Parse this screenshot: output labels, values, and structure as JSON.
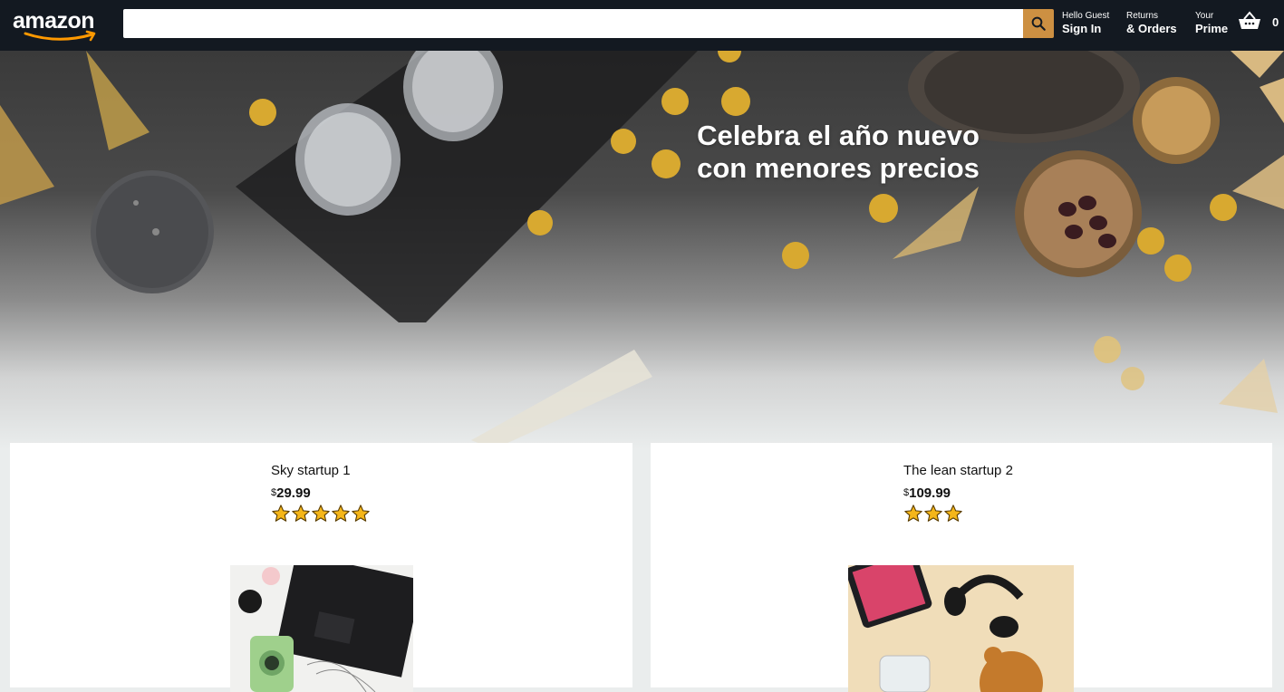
{
  "header": {
    "logo_text": "amazon",
    "search": {
      "value": "",
      "placeholder": ""
    },
    "nav": [
      {
        "line1": "Hello Guest",
        "line2": "Sign In"
      },
      {
        "line1": "Returns",
        "line2": "& Orders"
      },
      {
        "line1": "Your",
        "line2": "Prime"
      }
    ],
    "basket_count": "0",
    "icons": {
      "search": "search-icon",
      "basket": "basket-icon"
    }
  },
  "hero": {
    "title_line1": "Celebra el año nuevo",
    "title_line2": "con menores precios"
  },
  "products": [
    {
      "title": "Sky startup 1",
      "currency": "$",
      "price": "29.99",
      "rating": 5
    },
    {
      "title": "The lean startup 2",
      "currency": "$",
      "price": "109.99",
      "rating": 3
    }
  ],
  "colors": {
    "header_bg": "#131921",
    "search_btn": "#cd9042",
    "star": "#f5b619",
    "page_bg": "#eaeded"
  }
}
